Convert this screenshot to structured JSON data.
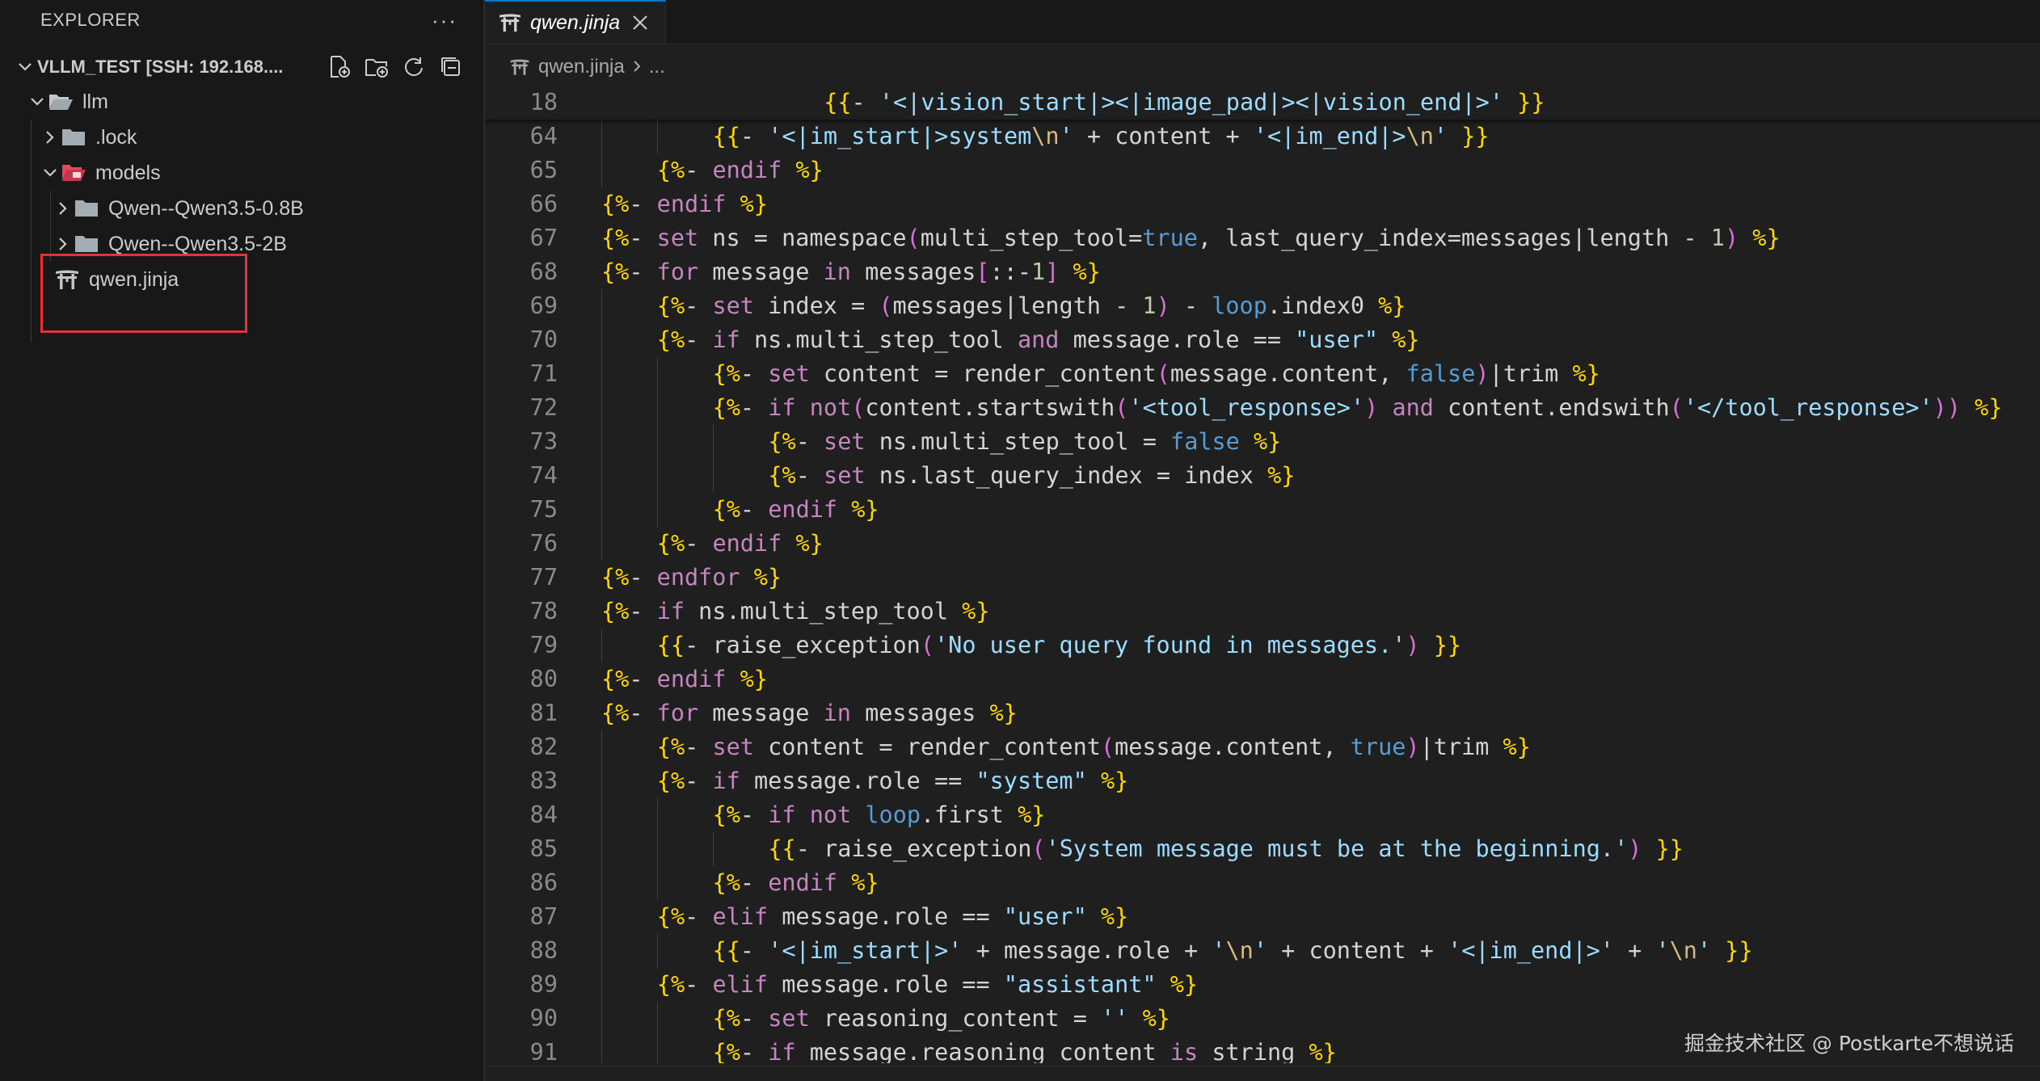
{
  "sidebar": {
    "title": "EXPLORER",
    "more": "···",
    "section_title": "VLLM_TEST [SSH: 192.168....",
    "tree": {
      "llm": "llm",
      "lock": ".lock",
      "models": "models",
      "qwen08": "Qwen--Qwen3.5-0.8B",
      "qwen2": "Qwen--Qwen3.5-2B",
      "jinja": "qwen.jinja"
    }
  },
  "editor": {
    "tab_label": "qwen.jinja",
    "breadcrumb_file": "qwen.jinja",
    "breadcrumb_more": "..."
  },
  "code_lines": [
    {
      "n": "18",
      "ind": 4,
      "sticky": true,
      "t": [
        [
          "dl",
          "{{"
        ],
        [
          "op",
          "- "
        ],
        [
          "st",
          "'<|vision_start|><|image_pad|><|vision_end|>'"
        ],
        [
          "op",
          " "
        ],
        [
          "dl",
          "}}"
        ]
      ]
    },
    {
      "n": "64",
      "ind": 2,
      "t": [
        [
          "dl",
          "{{"
        ],
        [
          "op",
          "- "
        ],
        [
          "st",
          "'<|im_start|>system"
        ],
        [
          "es",
          "\\n"
        ],
        [
          "st",
          "'"
        ],
        [
          "op",
          " + content + "
        ],
        [
          "st",
          "'<|im_end|>"
        ],
        [
          "es",
          "\\n"
        ],
        [
          "st",
          "'"
        ],
        [
          "op",
          " "
        ],
        [
          "dl",
          "}}"
        ]
      ]
    },
    {
      "n": "65",
      "ind": 1,
      "t": [
        [
          "dl",
          "{%"
        ],
        [
          "op",
          "- "
        ],
        [
          "kw",
          "endif"
        ],
        [
          "op",
          " "
        ],
        [
          "dl",
          "%}"
        ]
      ]
    },
    {
      "n": "66",
      "ind": 0,
      "t": [
        [
          "dl",
          "{%"
        ],
        [
          "op",
          "- "
        ],
        [
          "kw",
          "endif"
        ],
        [
          "op",
          " "
        ],
        [
          "dl",
          "%}"
        ]
      ]
    },
    {
      "n": "67",
      "ind": 0,
      "t": [
        [
          "dl",
          "{%"
        ],
        [
          "op",
          "- "
        ],
        [
          "kw",
          "set"
        ],
        [
          "op",
          " ns = namespace"
        ],
        [
          "br",
          "("
        ],
        [
          "op",
          "multi_step_tool="
        ],
        [
          "bo",
          "true"
        ],
        [
          "op",
          ", last_query_index=messages|length - "
        ],
        [
          "nu",
          "1"
        ],
        [
          "br",
          ")"
        ],
        [
          "op",
          " "
        ],
        [
          "dl",
          "%}"
        ]
      ]
    },
    {
      "n": "68",
      "ind": 0,
      "t": [
        [
          "dl",
          "{%"
        ],
        [
          "op",
          "- "
        ],
        [
          "kw",
          "for"
        ],
        [
          "op",
          " message "
        ],
        [
          "kw",
          "in"
        ],
        [
          "op",
          " messages"
        ],
        [
          "br",
          "["
        ],
        [
          "op",
          "::-"
        ],
        [
          "nu",
          "1"
        ],
        [
          "br",
          "]"
        ],
        [
          "op",
          " "
        ],
        [
          "dl",
          "%}"
        ]
      ]
    },
    {
      "n": "69",
      "ind": 1,
      "t": [
        [
          "dl",
          "{%"
        ],
        [
          "op",
          "- "
        ],
        [
          "kw",
          "set"
        ],
        [
          "op",
          " index = "
        ],
        [
          "br",
          "("
        ],
        [
          "op",
          "messages|length - "
        ],
        [
          "nu",
          "1"
        ],
        [
          "br",
          ")"
        ],
        [
          "op",
          " - "
        ],
        [
          "bo",
          "loop"
        ],
        [
          "op",
          ".index0 "
        ],
        [
          "dl",
          "%}"
        ]
      ]
    },
    {
      "n": "70",
      "ind": 1,
      "t": [
        [
          "dl",
          "{%"
        ],
        [
          "op",
          "- "
        ],
        [
          "kw",
          "if"
        ],
        [
          "op",
          " ns.multi_step_tool "
        ],
        [
          "kw",
          "and"
        ],
        [
          "op",
          " message.role == "
        ],
        [
          "st",
          "\"user\""
        ],
        [
          "op",
          " "
        ],
        [
          "dl",
          "%}"
        ]
      ]
    },
    {
      "n": "71",
      "ind": 2,
      "t": [
        [
          "dl",
          "{%"
        ],
        [
          "op",
          "- "
        ],
        [
          "kw",
          "set"
        ],
        [
          "op",
          " content = render_content"
        ],
        [
          "br",
          "("
        ],
        [
          "op",
          "message.content, "
        ],
        [
          "bo",
          "false"
        ],
        [
          "br",
          ")"
        ],
        [
          "op",
          "|trim "
        ],
        [
          "dl",
          "%}"
        ]
      ]
    },
    {
      "n": "72",
      "ind": 2,
      "t": [
        [
          "dl",
          "{%"
        ],
        [
          "op",
          "- "
        ],
        [
          "kw",
          "if not"
        ],
        [
          "br",
          "("
        ],
        [
          "op",
          "content.startswith"
        ],
        [
          "br",
          "("
        ],
        [
          "st",
          "'<tool_response>'"
        ],
        [
          "br",
          ")"
        ],
        [
          "op",
          " "
        ],
        [
          "kw",
          "and"
        ],
        [
          "op",
          " content.endswith"
        ],
        [
          "br",
          "("
        ],
        [
          "st",
          "'</tool_response>'"
        ],
        [
          "br",
          "))"
        ],
        [
          "op",
          " "
        ],
        [
          "dl",
          "%}"
        ]
      ]
    },
    {
      "n": "73",
      "ind": 3,
      "t": [
        [
          "dl",
          "{%"
        ],
        [
          "op",
          "- "
        ],
        [
          "kw",
          "set"
        ],
        [
          "op",
          " ns.multi_step_tool = "
        ],
        [
          "bo",
          "false"
        ],
        [
          "op",
          " "
        ],
        [
          "dl",
          "%}"
        ]
      ]
    },
    {
      "n": "74",
      "ind": 3,
      "t": [
        [
          "dl",
          "{%"
        ],
        [
          "op",
          "- "
        ],
        [
          "kw",
          "set"
        ],
        [
          "op",
          " ns.last_query_index = index "
        ],
        [
          "dl",
          "%}"
        ]
      ]
    },
    {
      "n": "75",
      "ind": 2,
      "t": [
        [
          "dl",
          "{%"
        ],
        [
          "op",
          "- "
        ],
        [
          "kw",
          "endif"
        ],
        [
          "op",
          " "
        ],
        [
          "dl",
          "%}"
        ]
      ]
    },
    {
      "n": "76",
      "ind": 1,
      "t": [
        [
          "dl",
          "{%"
        ],
        [
          "op",
          "- "
        ],
        [
          "kw",
          "endif"
        ],
        [
          "op",
          " "
        ],
        [
          "dl",
          "%}"
        ]
      ]
    },
    {
      "n": "77",
      "ind": 0,
      "t": [
        [
          "dl",
          "{%"
        ],
        [
          "op",
          "- "
        ],
        [
          "kw",
          "endfor"
        ],
        [
          "op",
          " "
        ],
        [
          "dl",
          "%}"
        ]
      ]
    },
    {
      "n": "78",
      "ind": 0,
      "t": [
        [
          "dl",
          "{%"
        ],
        [
          "op",
          "- "
        ],
        [
          "kw",
          "if"
        ],
        [
          "op",
          " ns.multi_step_tool "
        ],
        [
          "dl",
          "%}"
        ]
      ]
    },
    {
      "n": "79",
      "ind": 1,
      "t": [
        [
          "dl",
          "{{"
        ],
        [
          "op",
          "- raise_exception"
        ],
        [
          "br",
          "("
        ],
        [
          "st",
          "'No user query found in messages.'"
        ],
        [
          "br",
          ")"
        ],
        [
          "op",
          " "
        ],
        [
          "dl",
          "}}"
        ]
      ]
    },
    {
      "n": "80",
      "ind": 0,
      "t": [
        [
          "dl",
          "{%"
        ],
        [
          "op",
          "- "
        ],
        [
          "kw",
          "endif"
        ],
        [
          "op",
          " "
        ],
        [
          "dl",
          "%}"
        ]
      ]
    },
    {
      "n": "81",
      "ind": 0,
      "t": [
        [
          "dl",
          "{%"
        ],
        [
          "op",
          "- "
        ],
        [
          "kw",
          "for"
        ],
        [
          "op",
          " message "
        ],
        [
          "kw",
          "in"
        ],
        [
          "op",
          " messages "
        ],
        [
          "dl",
          "%}"
        ]
      ]
    },
    {
      "n": "82",
      "ind": 1,
      "t": [
        [
          "dl",
          "{%"
        ],
        [
          "op",
          "- "
        ],
        [
          "kw",
          "set"
        ],
        [
          "op",
          " content = render_content"
        ],
        [
          "br",
          "("
        ],
        [
          "op",
          "message.content, "
        ],
        [
          "bo",
          "true"
        ],
        [
          "br",
          ")"
        ],
        [
          "op",
          "|trim "
        ],
        [
          "dl",
          "%}"
        ]
      ]
    },
    {
      "n": "83",
      "ind": 1,
      "t": [
        [
          "dl",
          "{%"
        ],
        [
          "op",
          "- "
        ],
        [
          "kw",
          "if"
        ],
        [
          "op",
          " message.role == "
        ],
        [
          "st",
          "\"system\""
        ],
        [
          "op",
          " "
        ],
        [
          "dl",
          "%}"
        ]
      ]
    },
    {
      "n": "84",
      "ind": 2,
      "t": [
        [
          "dl",
          "{%"
        ],
        [
          "op",
          "- "
        ],
        [
          "kw",
          "if not"
        ],
        [
          "op",
          " "
        ],
        [
          "bo",
          "loop"
        ],
        [
          "op",
          ".first "
        ],
        [
          "dl",
          "%}"
        ]
      ]
    },
    {
      "n": "85",
      "ind": 3,
      "t": [
        [
          "dl",
          "{{"
        ],
        [
          "op",
          "- raise_exception"
        ],
        [
          "br",
          "("
        ],
        [
          "st",
          "'System message must be at the beginning.'"
        ],
        [
          "br",
          ")"
        ],
        [
          "op",
          " "
        ],
        [
          "dl",
          "}}"
        ]
      ]
    },
    {
      "n": "86",
      "ind": 2,
      "t": [
        [
          "dl",
          "{%"
        ],
        [
          "op",
          "- "
        ],
        [
          "kw",
          "endif"
        ],
        [
          "op",
          " "
        ],
        [
          "dl",
          "%}"
        ]
      ]
    },
    {
      "n": "87",
      "ind": 1,
      "t": [
        [
          "dl",
          "{%"
        ],
        [
          "op",
          "- "
        ],
        [
          "kw",
          "elif"
        ],
        [
          "op",
          " message.role == "
        ],
        [
          "st",
          "\"user\""
        ],
        [
          "op",
          " "
        ],
        [
          "dl",
          "%}"
        ]
      ]
    },
    {
      "n": "88",
      "ind": 2,
      "t": [
        [
          "dl",
          "{{"
        ],
        [
          "op",
          "- "
        ],
        [
          "st",
          "'<|im_start|>'"
        ],
        [
          "op",
          " + message.role + "
        ],
        [
          "st",
          "'"
        ],
        [
          "es",
          "\\n"
        ],
        [
          "st",
          "'"
        ],
        [
          "op",
          " + content + "
        ],
        [
          "st",
          "'<|im_end|>'"
        ],
        [
          "op",
          " + "
        ],
        [
          "st",
          "'"
        ],
        [
          "es",
          "\\n"
        ],
        [
          "st",
          "'"
        ],
        [
          "op",
          " "
        ],
        [
          "dl",
          "}}"
        ]
      ]
    },
    {
      "n": "89",
      "ind": 1,
      "t": [
        [
          "dl",
          "{%"
        ],
        [
          "op",
          "- "
        ],
        [
          "kw",
          "elif"
        ],
        [
          "op",
          " message.role == "
        ],
        [
          "st",
          "\"assistant\""
        ],
        [
          "op",
          " "
        ],
        [
          "dl",
          "%}"
        ]
      ]
    },
    {
      "n": "90",
      "ind": 2,
      "t": [
        [
          "dl",
          "{%"
        ],
        [
          "op",
          "- "
        ],
        [
          "kw",
          "set"
        ],
        [
          "op",
          " reasoning_content = "
        ],
        [
          "st",
          "''"
        ],
        [
          "op",
          " "
        ],
        [
          "dl",
          "%}"
        ]
      ]
    },
    {
      "n": "91",
      "ind": 2,
      "t": [
        [
          "dl",
          "{%"
        ],
        [
          "op",
          "- "
        ],
        [
          "kw",
          "if"
        ],
        [
          "op",
          " message.reasoning_content "
        ],
        [
          "kw",
          "is"
        ],
        [
          "op",
          " string "
        ],
        [
          "dl",
          "%}"
        ]
      ]
    }
  ],
  "watermark": "掘金技术社区 @ Postkarte不想说话",
  "colors": {
    "accent": "#0078d4",
    "highlight_box": "#e5323a",
    "keyword": "#c586c0",
    "delimiter": "#ffd700",
    "string": "#9cdcfe",
    "boolean": "#569cd6"
  }
}
